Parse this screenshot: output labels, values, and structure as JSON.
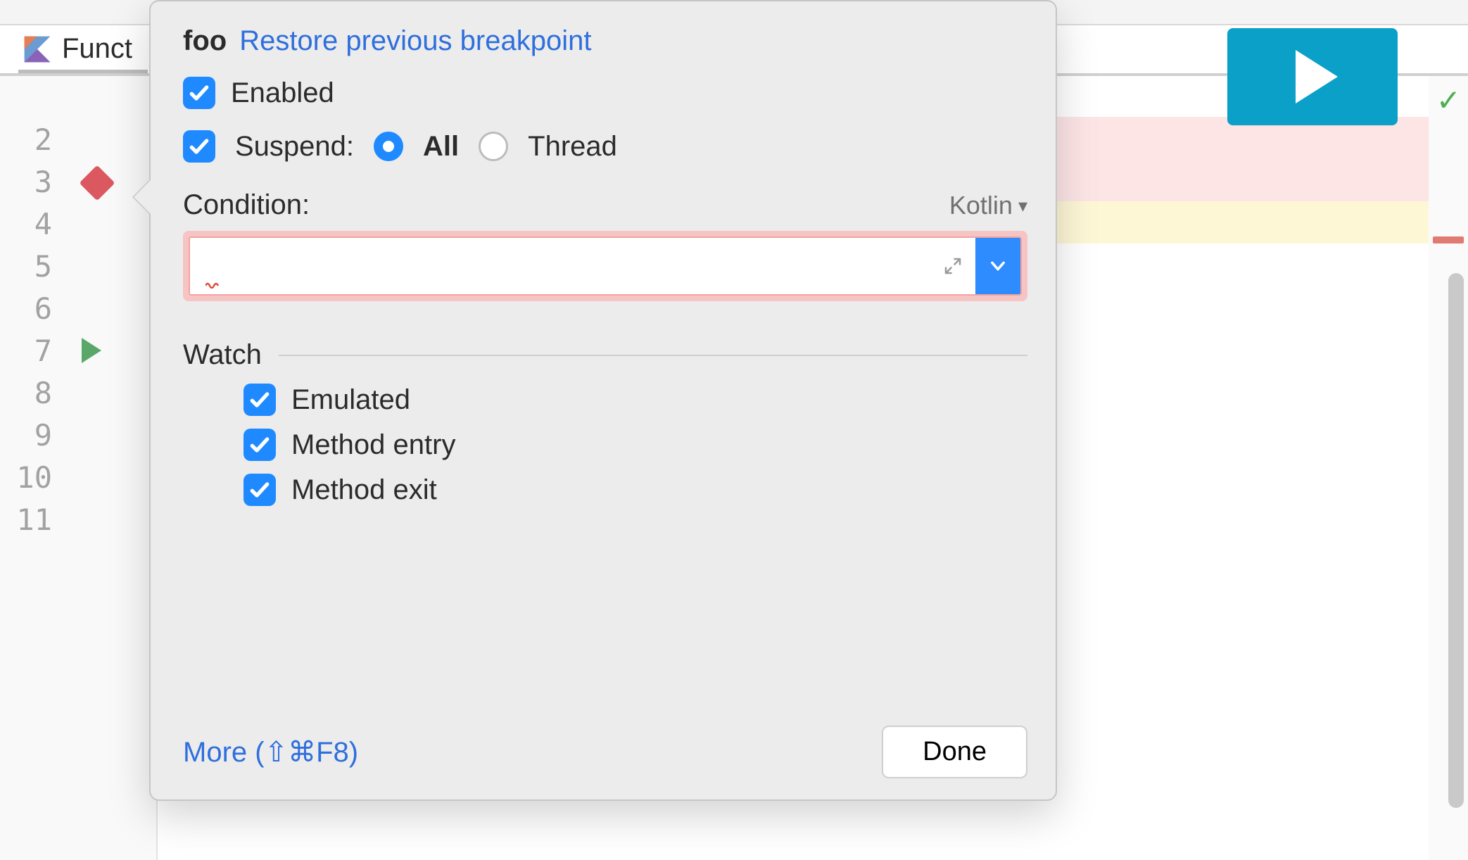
{
  "tab": {
    "label": "Funct"
  },
  "gutter": {
    "lines": [
      "2",
      "3",
      "4",
      "5",
      "6",
      "7",
      "8",
      "9",
      "10",
      "11"
    ],
    "breakpoint_line_index": 1,
    "run_line_index": 5
  },
  "run_button": {
    "aria": "Run"
  },
  "ruler": {
    "status_ok": true
  },
  "popover": {
    "title": "foo",
    "restore_link": "Restore previous breakpoint",
    "enabled_label": "Enabled",
    "suspend_label": "Suspend:",
    "suspend_all": "All",
    "suspend_thread": "Thread",
    "condition_label": "Condition:",
    "language": "Kotlin",
    "condition_value": "",
    "watch_section": "Watch",
    "watch_emulated": "Emulated",
    "watch_method_entry": "Method entry",
    "watch_method_exit": "Method exit",
    "more_label": "More (⇧⌘F8)",
    "done_label": "Done"
  }
}
